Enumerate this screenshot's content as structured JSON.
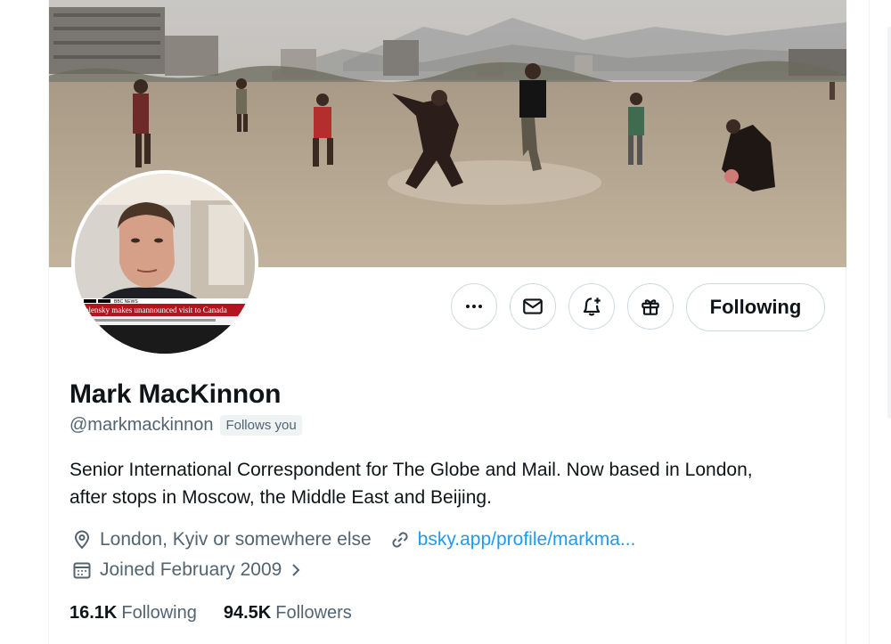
{
  "profile": {
    "name": "Mark MacKinnon",
    "handle": "@markmackinnon",
    "follows_you": "Follows you",
    "bio_lines": [
      "Senior International Correspondent for The Globe and Mail. Now based in London,",
      "after stops in Moscow, the Middle East and Beijing."
    ],
    "location": "London, Kyiv or somewhere else",
    "website": "bsky.app/profile/markma...",
    "joined": "Joined February 2009",
    "following_count": "16.1K",
    "following_label": "Following",
    "followers_count": "94.5K",
    "followers_label": "Followers"
  },
  "avatar_caption": {
    "logo": "BBC NEWS",
    "headline": "Zelensky makes unannounced visit to Canada",
    "ticker": "BBC ... news ticker"
  },
  "actions": {
    "more": "more-icon",
    "message": "mail-icon",
    "notify": "bell-plus-icon",
    "gift": "gift-icon",
    "follow_label": "Following"
  },
  "colors": {
    "text": "#0f1419",
    "secondary": "#536471",
    "link": "#1d9bf0",
    "border": "#cfd9de"
  }
}
